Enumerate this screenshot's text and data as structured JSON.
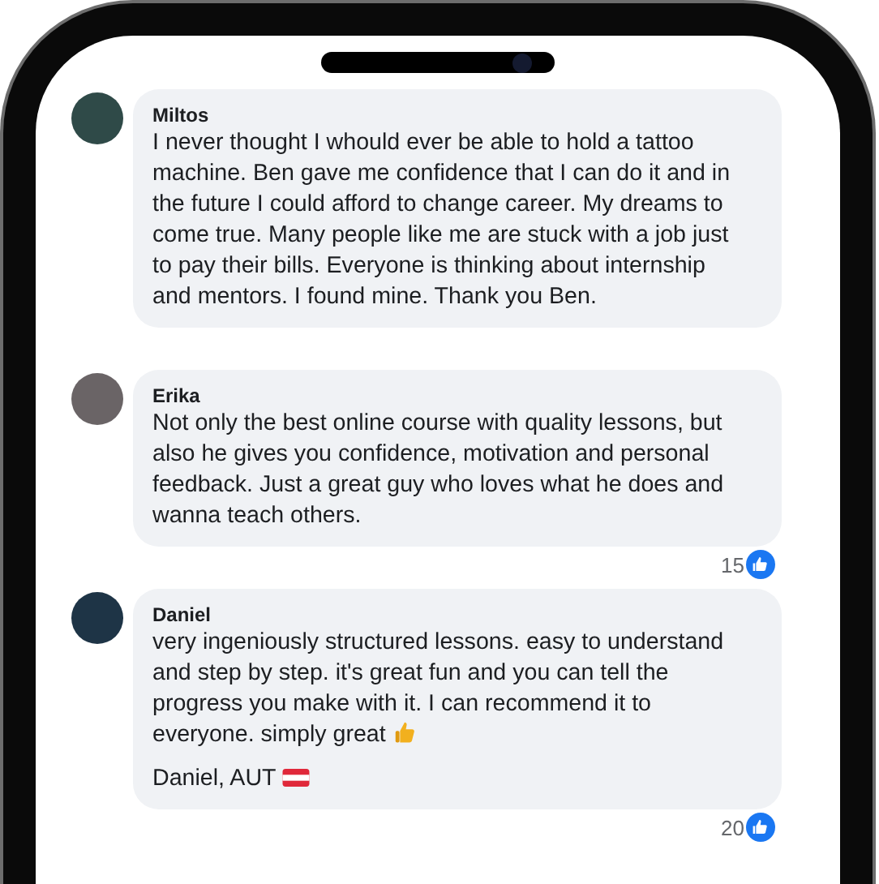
{
  "comments": [
    {
      "author": "Miltos",
      "text": "I never thought I whould ever be able to hold a tattoo machine. Ben gave me confidence that I can do it and in the future I could afford to change career. My dreams to come true. Many people like me are stuck with a job just to pay their bills. Everyone is thinking about internship and mentors. I found mine. Thank you Ben."
    },
    {
      "author": "Erika",
      "text": "Not only the best online course with quality lessons, but also he gives you confidence, motivation and personal feedback. Just a great guy who loves what he does and wanna teach others.",
      "likes": "15"
    },
    {
      "author": "Daniel",
      "text": "very ingeniously structured lessons. easy to understand and step by step. it's great fun and you can tell the progress you make with it. I can recommend it to everyone. simply great",
      "thumbs_up": true,
      "signature": "Daniel, AUT",
      "flag": true,
      "likes": "20"
    }
  ]
}
